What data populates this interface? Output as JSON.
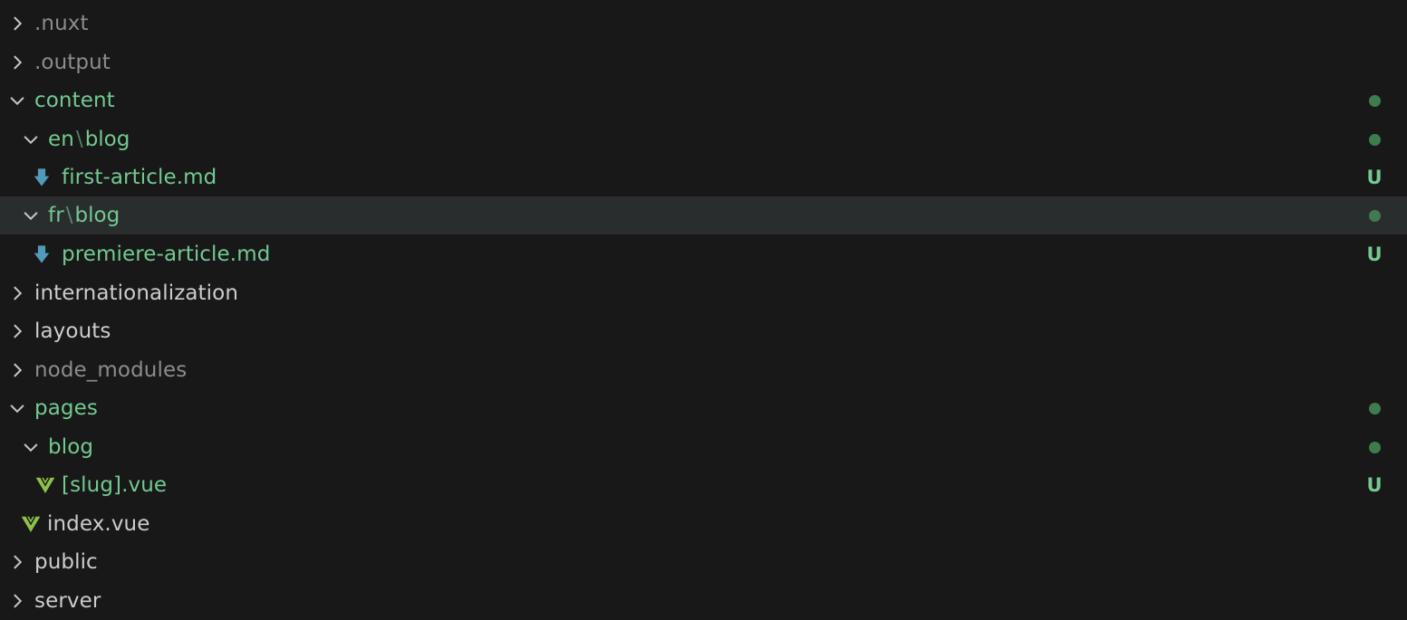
{
  "colors": {
    "background": "#181818",
    "selected_row": "#2a2d2e",
    "untracked_green": "#73c991",
    "normal_text": "#cccccc",
    "ignored_text": "#8c8c8c",
    "dot_green": "#3e7c4f",
    "markdown_icon_blue": "#519aba",
    "vue_icon_green": "#8dc149",
    "chevron": "#c5c5c5"
  },
  "explorer": {
    "rows": [
      {
        "label": ".nuxt",
        "kind": "folder",
        "expanded": false,
        "state": "ignored"
      },
      {
        "label": ".output",
        "kind": "folder",
        "expanded": false,
        "state": "ignored"
      },
      {
        "label": "content",
        "kind": "folder",
        "expanded": true,
        "state": "untracked",
        "decoration": "dot"
      },
      {
        "label": "en",
        "label_rest": "blog",
        "separator": "\\",
        "kind": "folder",
        "expanded": true,
        "state": "untracked",
        "decoration": "dot"
      },
      {
        "label": "first-article.md",
        "kind": "file",
        "icon": "markdown-icon",
        "state": "untracked",
        "decoration": "U"
      },
      {
        "label": "fr",
        "label_rest": "blog",
        "separator": "\\",
        "kind": "folder",
        "expanded": true,
        "state": "untracked",
        "decoration": "dot",
        "selected": true
      },
      {
        "label": "premiere-article.md",
        "kind": "file",
        "icon": "markdown-icon",
        "state": "untracked",
        "decoration": "U"
      },
      {
        "label": "internationalization",
        "kind": "folder",
        "expanded": false,
        "state": "normal"
      },
      {
        "label": "layouts",
        "kind": "folder",
        "expanded": false,
        "state": "normal"
      },
      {
        "label": "node_modules",
        "kind": "folder",
        "expanded": false,
        "state": "ignored"
      },
      {
        "label": "pages",
        "kind": "folder",
        "expanded": true,
        "state": "untracked",
        "decoration": "dot"
      },
      {
        "label": "blog",
        "kind": "folder",
        "expanded": true,
        "state": "untracked",
        "decoration": "dot"
      },
      {
        "label": "[slug].vue",
        "kind": "file",
        "icon": "vue-icon",
        "state": "untracked",
        "decoration": "U"
      },
      {
        "label": "index.vue",
        "kind": "file",
        "icon": "vue-icon",
        "state": "normal"
      },
      {
        "label": "public",
        "kind": "folder",
        "expanded": false,
        "state": "normal"
      },
      {
        "label": "server",
        "kind": "folder",
        "expanded": false,
        "state": "normal"
      }
    ]
  }
}
